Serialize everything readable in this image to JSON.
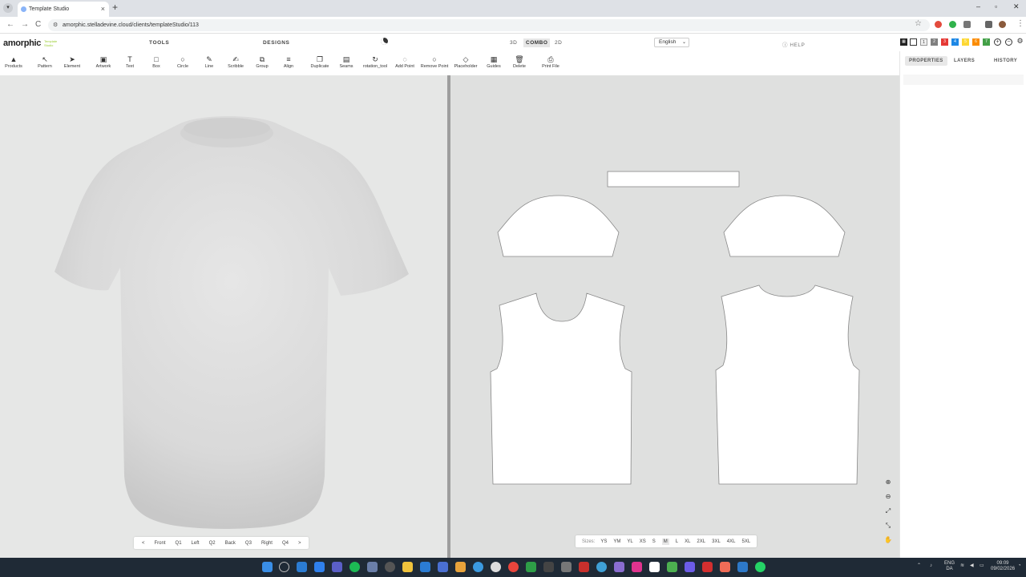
{
  "browser": {
    "tab_title": "Template Studio",
    "tab_close": "×",
    "new_tab": "+",
    "url": "amorphic.stelladevine.cloud/clients/templateStudio/113",
    "back": "←",
    "forward": "→",
    "reload": "C",
    "menu": "⋮",
    "minimize": "–",
    "maximize": "▫",
    "close": "✕"
  },
  "app": {
    "logo": "amorphic",
    "logo_tag": "Template Studio",
    "nav": {
      "tools": "TOOLS",
      "designs": "DESIGNS"
    },
    "modes": {
      "three_d": "3D",
      "combo": "COMBO",
      "two_d": "2D"
    },
    "language": "English",
    "help": "HELP",
    "color_slots": [
      {
        "label": "",
        "color": "#ffffff"
      },
      {
        "label": "1",
        "color": "#f0f0f0"
      },
      {
        "label": "2",
        "color": "#808080"
      },
      {
        "label": "3",
        "color": "#e53935"
      },
      {
        "label": "4",
        "color": "#1e88e5"
      },
      {
        "label": "5",
        "color": "#fdd835"
      },
      {
        "label": "6",
        "color": "#fb8c00"
      },
      {
        "label": "7",
        "color": "#43a047"
      }
    ]
  },
  "toolbar": [
    {
      "label": "Products",
      "icon": "▲"
    },
    {
      "label": "Pattern",
      "icon": "↖"
    },
    {
      "label": "Element",
      "icon": "➤"
    },
    {
      "label": "Artwork",
      "icon": "▣"
    },
    {
      "label": "Text",
      "icon": "T"
    },
    {
      "label": "Box",
      "icon": "□"
    },
    {
      "label": "Circle",
      "icon": "○"
    },
    {
      "label": "Line",
      "icon": "✎"
    },
    {
      "label": "Scribble",
      "icon": "✍"
    },
    {
      "label": "Group",
      "icon": "⧉"
    },
    {
      "label": "Align",
      "icon": "≡"
    },
    {
      "label": "Duplicate",
      "icon": "❐"
    },
    {
      "label": "Seams",
      "icon": "▤"
    },
    {
      "label": "rotation_tool",
      "icon": "↻"
    },
    {
      "label": "Add Point",
      "icon": "◌"
    },
    {
      "label": "Remove Point",
      "icon": "○"
    },
    {
      "label": "Placeholder",
      "icon": "◇"
    },
    {
      "label": "Guides",
      "icon": "▦"
    },
    {
      "label": "Delete",
      "icon": "🗑"
    },
    {
      "label": "Print File",
      "icon": "⎙"
    }
  ],
  "right_panel": {
    "tabs": [
      "PROPERTIES",
      "LAYERS",
      "HISTORY"
    ]
  },
  "view_nav": [
    "<",
    "Front",
    "Q1",
    "Left",
    "Q2",
    "Back",
    "Q3",
    "Right",
    "Q4",
    ">"
  ],
  "sizes": {
    "label": "Sizes:",
    "options": [
      "YS",
      "YM",
      "YL",
      "XS",
      "S",
      "M",
      "L",
      "XL",
      "2XL",
      "3XL",
      "4XL",
      "5XL"
    ],
    "selected": "M"
  },
  "zoom_controls": [
    "⊕",
    "⊖",
    "⤢",
    "⤡",
    "✋"
  ],
  "colors": {
    "view3d_bg": "#e6e7e6",
    "view2d_bg": "#dfe0df",
    "taskbar": "#1f2a36"
  },
  "tray": {
    "lang_top": "ENG",
    "lang_bottom": "DA",
    "time": "09:09",
    "date": "09/02/2026"
  }
}
